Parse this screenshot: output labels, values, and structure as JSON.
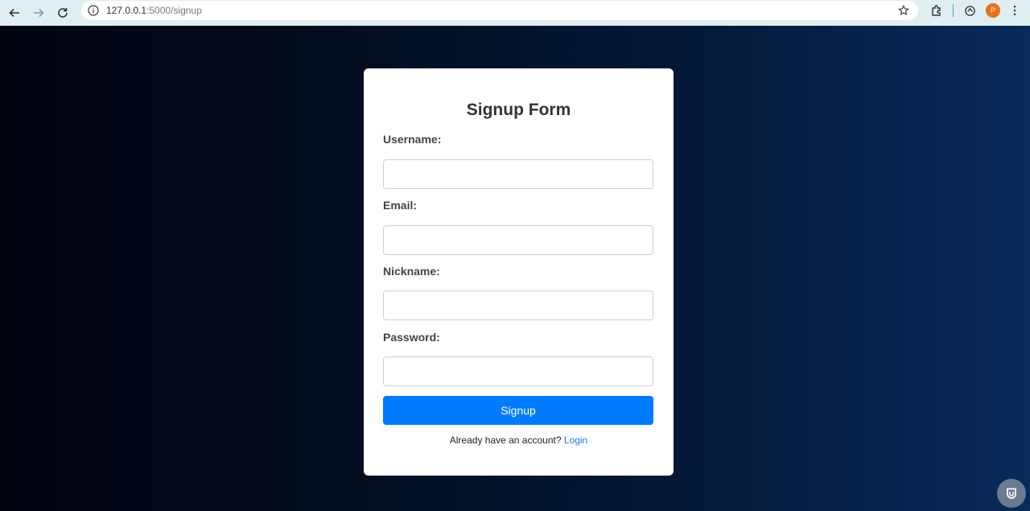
{
  "browser": {
    "url_host": "127.0.0.1",
    "url_path": ":5000/signup",
    "profile_initial": "P"
  },
  "form": {
    "title": "Signup Form",
    "fields": [
      {
        "label": "Username:",
        "value": ""
      },
      {
        "label": "Email:",
        "value": ""
      },
      {
        "label": "Nickname:",
        "value": ""
      },
      {
        "label": "Password:",
        "value": ""
      }
    ],
    "submit_label": "Signup",
    "login_prompt": "Already have an account?",
    "login_link": "Login"
  },
  "colors": {
    "accent": "#007bff",
    "link": "#1f7ad8",
    "background_start": "#01040d",
    "background_end": "#092a5a"
  },
  "icons": [
    "back-arrow-icon",
    "forward-arrow-icon",
    "reload-icon",
    "info-icon",
    "star-icon",
    "extensions-icon",
    "sync-icon",
    "kebab-menu-icon",
    "shield-icon"
  ]
}
